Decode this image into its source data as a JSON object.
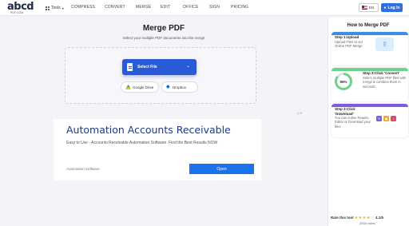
{
  "nav": {
    "logo_text": "abcd",
    "logo_sub": "PDF.COM",
    "tools_label": "Tools",
    "links": [
      "COMPRESS",
      "CONVERT",
      "MERGE",
      "EDIT",
      "OFFICE",
      "SIGN",
      "PRICING"
    ],
    "language": "EN",
    "login_label": "Log In"
  },
  "main": {
    "title": "Merge PDF",
    "subtitle": "Select your multiple PDF documents into the merge",
    "select_label": "Select File",
    "gdrive_label": "Google Drive",
    "dropbox_label": "Dropbox"
  },
  "ad": {
    "title": "Automation Accounts Receivable",
    "description": "Easy to Use - Accounts Receivable Automation Software. Find the Best Results NOW",
    "source": "Automation Software",
    "button_label": "Open"
  },
  "sidebar": {
    "title": "How to Merge PDF",
    "steps": [
      {
        "title": "Step 1:Upload",
        "description": "Upload Files to our Online PDF Merge",
        "color": "#3a8ee6"
      },
      {
        "title": "Step 2:Click 'Convert'",
        "description": "Select multiple PDF files with merge & combine them in seconds",
        "color": "#6fd28a",
        "percent": "86%"
      },
      {
        "title": "Step 3:Click 'Download'",
        "description": "You can online Reader, Editor or Download your files",
        "color": "#7b5ce0"
      }
    ],
    "rating_label": "Rate this tool",
    "rating_value": "4.1/5",
    "votes": "2002 votes"
  },
  "colors": {
    "accent": "#2a5bd7",
    "ad_button": "#1a73e8",
    "ad_title": "#1a3a8a"
  }
}
